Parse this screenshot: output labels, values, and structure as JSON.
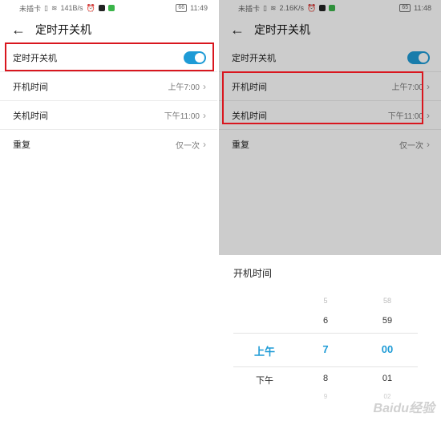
{
  "left": {
    "status": {
      "carrier": "未插卡",
      "speed": "141B/s",
      "battery": "66",
      "time": "11:49"
    },
    "header": {
      "title": "定时开关机"
    },
    "rows": [
      {
        "label": "定时开关机",
        "value": ""
      },
      {
        "label": "开机时间",
        "value": "上午7:00"
      },
      {
        "label": "关机时间",
        "value": "下午11:00"
      },
      {
        "label": "重复",
        "value": "仅一次"
      }
    ]
  },
  "right": {
    "status": {
      "carrier": "未插卡",
      "speed": "2.16K/s",
      "battery": "65",
      "time": "11:48"
    },
    "header": {
      "title": "定时开关机"
    },
    "rows": [
      {
        "label": "定时开关机",
        "value": ""
      },
      {
        "label": "开机时间",
        "value": "上午7:00"
      },
      {
        "label": "关机时间",
        "value": "下午11:00"
      },
      {
        "label": "重复",
        "value": "仅一次"
      }
    ],
    "sheet": {
      "title": "开机时间",
      "ampm": {
        "selected": "上午",
        "next": "下午"
      },
      "hours": {
        "prev2": "5",
        "prev1": "6",
        "selected": "7",
        "next1": "8",
        "next2": "9"
      },
      "minutes": {
        "prev2": "58",
        "prev1": "59",
        "selected": "00",
        "next1": "01",
        "next2": "02"
      }
    },
    "watermark": "Baidu经验"
  },
  "colors": {
    "accent": "#1e9bd6",
    "highlight": "#d9161e"
  }
}
